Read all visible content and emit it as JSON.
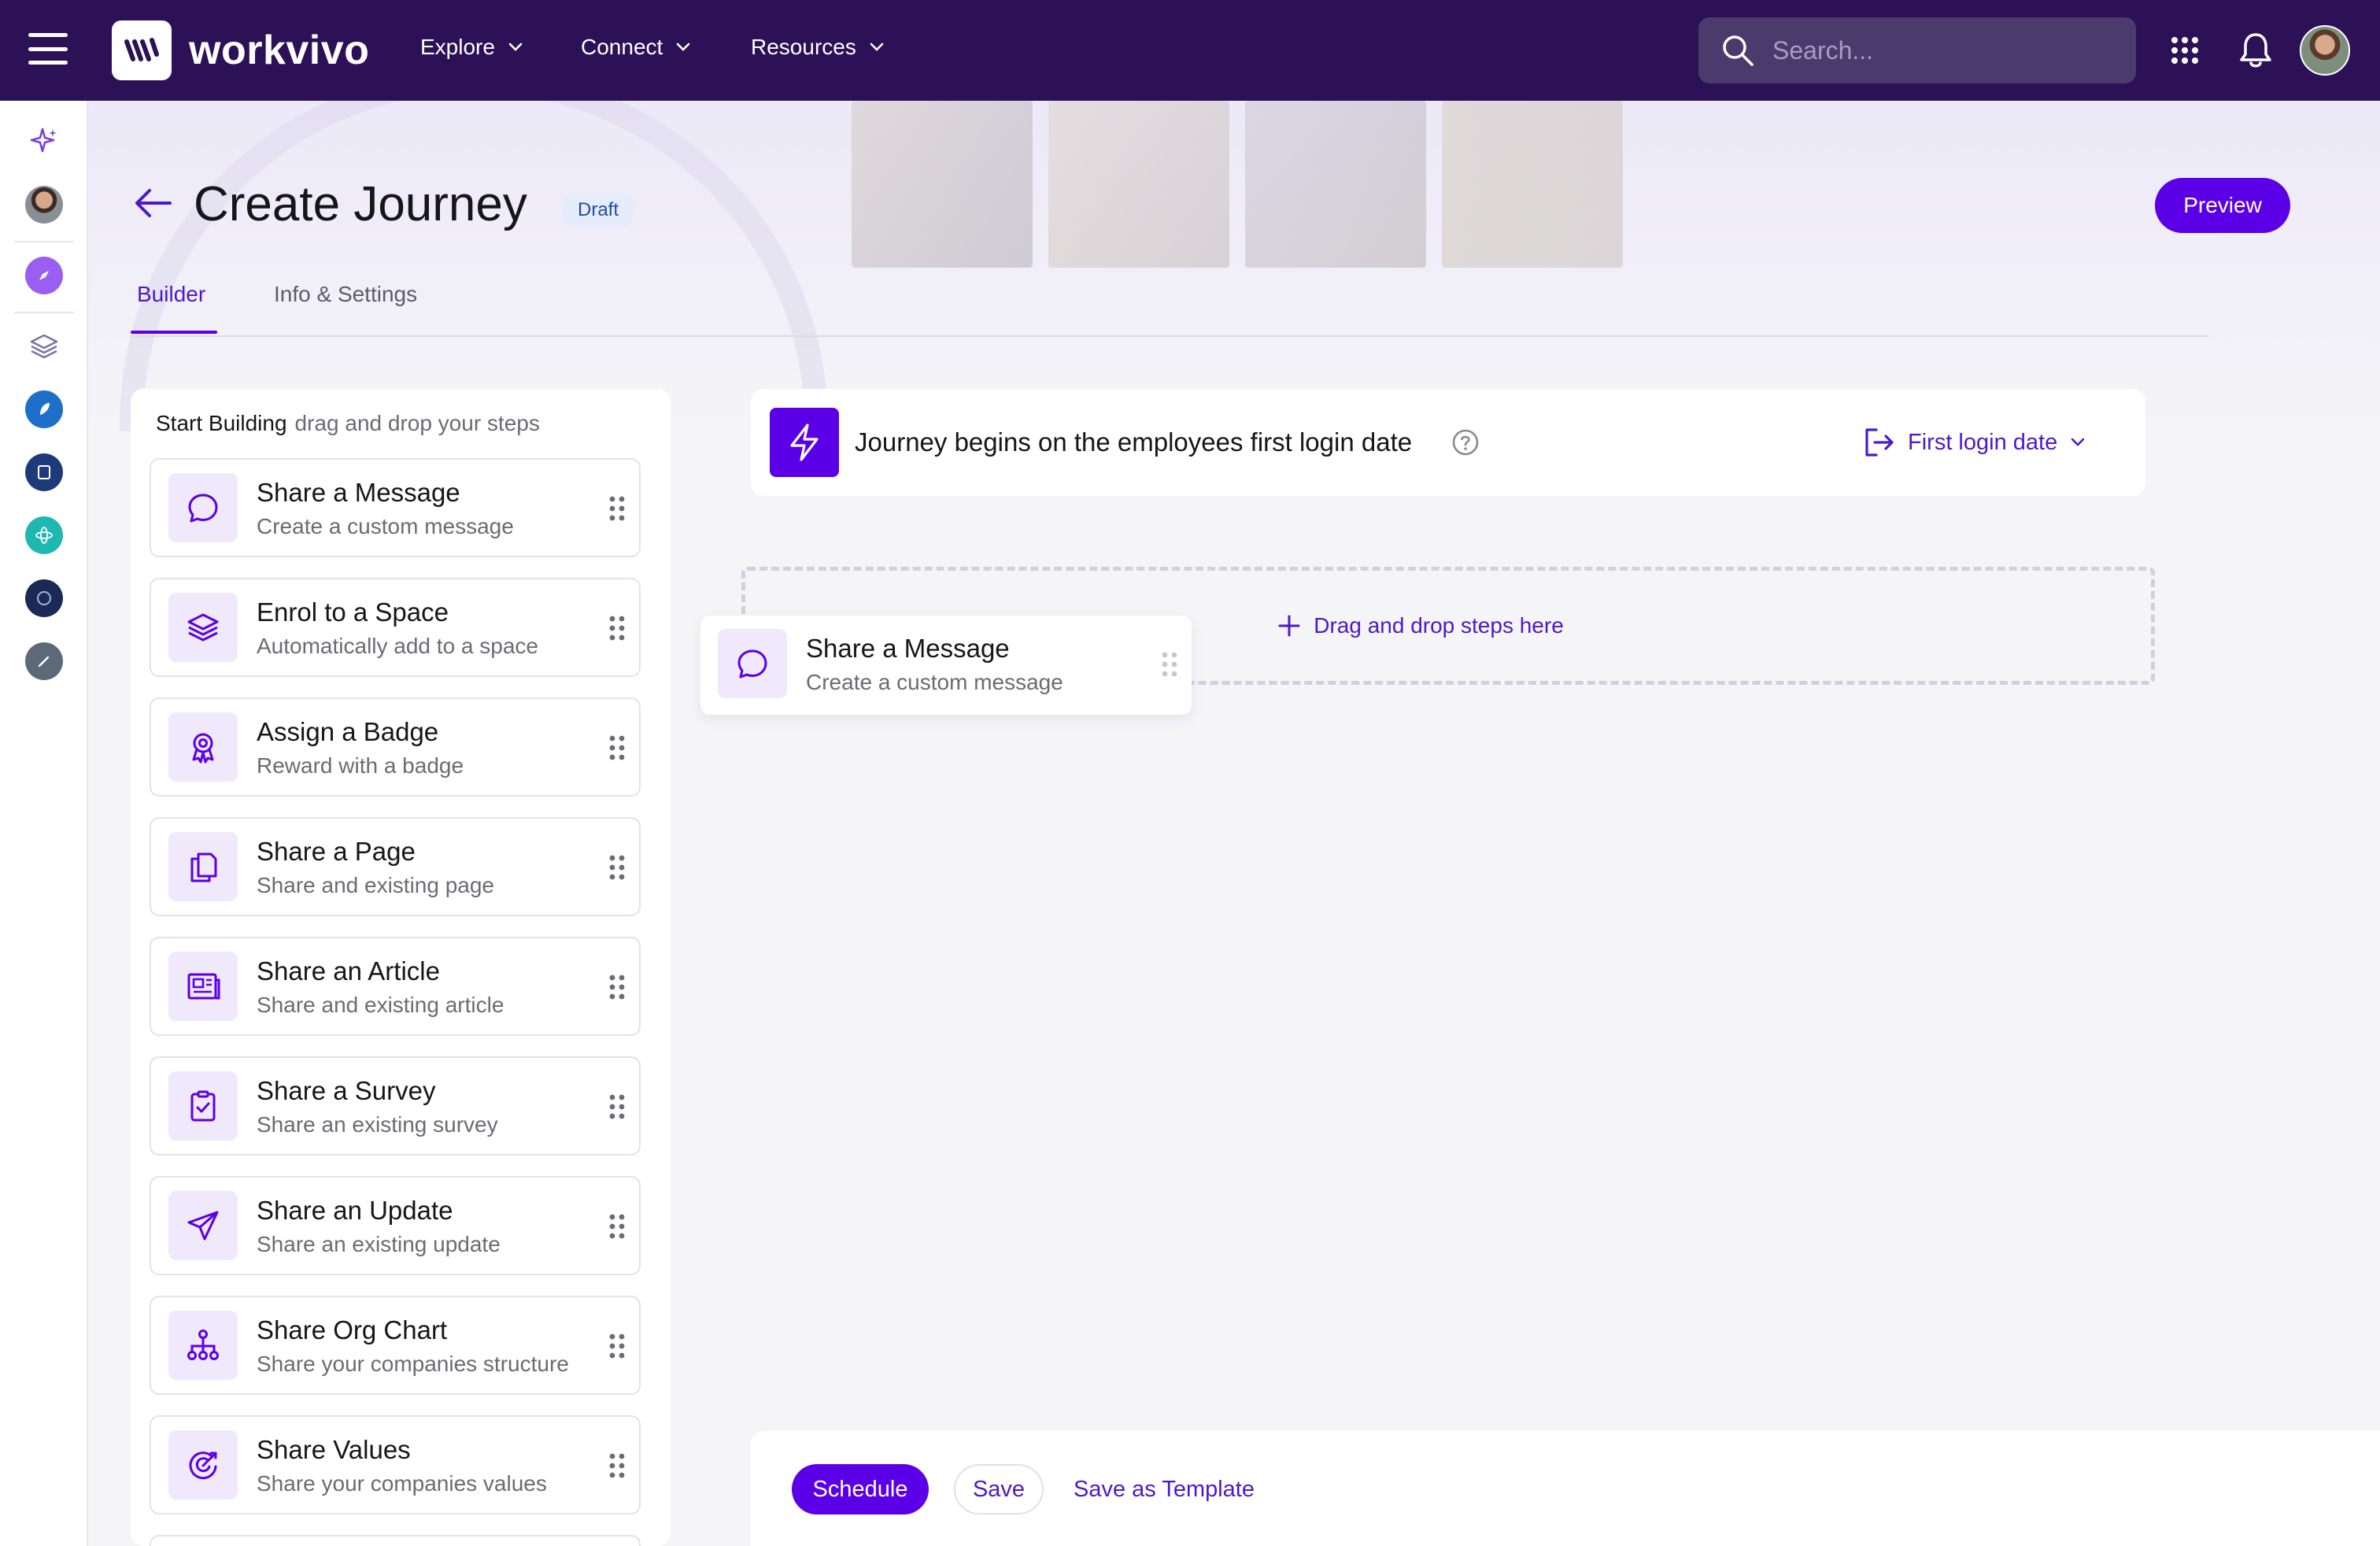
{
  "app": {
    "logo_text": "workvivo",
    "nav": [
      {
        "label": "Explore"
      },
      {
        "label": "Connect"
      },
      {
        "label": "Resources"
      }
    ],
    "search_placeholder": "Search..."
  },
  "page": {
    "title": "Create Journey",
    "status_badge": "Draft",
    "preview_label": "Preview",
    "tabs": [
      {
        "label": "Builder",
        "active": true
      },
      {
        "label": "Info & Settings",
        "active": false
      }
    ]
  },
  "steps_panel": {
    "heading": "Start Building",
    "hint": "drag and drop your steps",
    "steps": [
      {
        "title": "Share a Message",
        "subtitle": "Create a custom message",
        "icon": "message-bubble-icon"
      },
      {
        "title": "Enrol to a Space",
        "subtitle": "Automatically add to a space",
        "icon": "layers-icon"
      },
      {
        "title": "Assign a Badge",
        "subtitle": "Reward with a badge",
        "icon": "badge-icon"
      },
      {
        "title": "Share a Page",
        "subtitle": "Share and existing page",
        "icon": "page-icon"
      },
      {
        "title": "Share an Article",
        "subtitle": "Share and existing article",
        "icon": "article-icon"
      },
      {
        "title": "Share a Survey",
        "subtitle": "Share an existing survey",
        "icon": "survey-clipboard-icon"
      },
      {
        "title": "Share an Update",
        "subtitle": "Share an existing update",
        "icon": "paper-plane-icon"
      },
      {
        "title": "Share Org Chart",
        "subtitle": "Share your companies structure",
        "icon": "org-chart-icon"
      },
      {
        "title": "Share Values",
        "subtitle": "Share your companies values",
        "icon": "target-icon"
      }
    ]
  },
  "trigger": {
    "text": "Journey begins on the employees first login date",
    "select_value": "First login date"
  },
  "dropzone": {
    "label": "Drag and drop steps here"
  },
  "dragging_step": {
    "title": "Share a Message",
    "subtitle": "Create a custom message"
  },
  "footer": {
    "schedule_label": "Schedule",
    "save_label": "Save",
    "template_label": "Save as Template"
  },
  "colors": {
    "nav_bg": "#2c1157",
    "accent": "#5b00e6",
    "accent_text": "#4d19c8",
    "icon_tile": "#f0e8fb"
  }
}
